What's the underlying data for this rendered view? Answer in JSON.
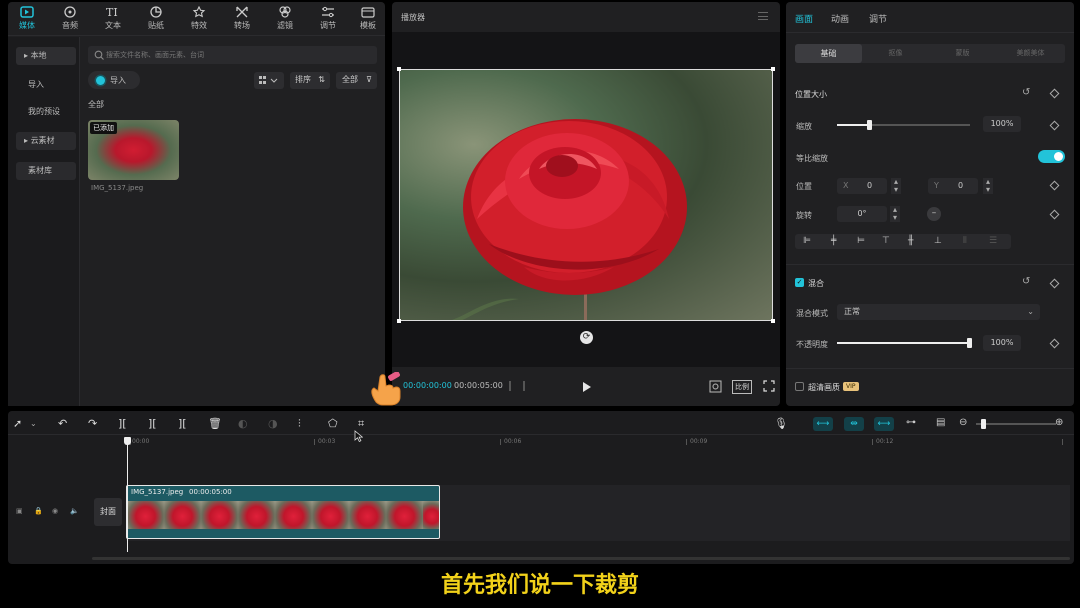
{
  "toolbar_tabs": [
    {
      "label": "媒体",
      "icon": "media-icon",
      "active": true
    },
    {
      "label": "音频",
      "icon": "audio-icon"
    },
    {
      "label": "文本",
      "icon": "text-icon"
    },
    {
      "label": "贴纸",
      "icon": "sticker-icon"
    },
    {
      "label": "特效",
      "icon": "effects-icon"
    },
    {
      "label": "转场",
      "icon": "transition-icon"
    },
    {
      "label": "滤镜",
      "icon": "filter-icon"
    },
    {
      "label": "调节",
      "icon": "adjust-icon"
    },
    {
      "label": "模板",
      "icon": "template-icon"
    }
  ],
  "sidebar": {
    "items": [
      "本地",
      "导入",
      "我的预设",
      "云素材",
      "素材库"
    ]
  },
  "media": {
    "search_placeholder": "搜索文件名称、画面元素、台词",
    "import_label": "导入",
    "sort_label": "排序",
    "filter_label": "全部",
    "section_label": "全部",
    "clip_badge": "已添加",
    "clip_name": "IMG_5137.jpeg"
  },
  "player": {
    "title": "播放器",
    "current_time": "00:00:00:00",
    "total_time": "00:00:05:00",
    "ratio_label": "比例"
  },
  "inspector": {
    "tabs": [
      "画面",
      "动画",
      "调节"
    ],
    "subtabs": [
      "基础",
      "抠像",
      "蒙版",
      "美颜美体"
    ],
    "position_size_title": "位置大小",
    "scale_label": "缩放",
    "scale_value": "100%",
    "scale_level": 0.25,
    "uniform_scale_label": "等比缩放",
    "position_label": "位置",
    "x_label": "X",
    "x_value": "0",
    "y_label": "Y",
    "y_value": "0",
    "rotate_label": "旋转",
    "rotate_value": "0°",
    "blend_title": "混合",
    "blend_mode_label": "混合模式",
    "blend_mode_value": "正常",
    "opacity_label": "不透明度",
    "opacity_value": "100%",
    "opacity_level": 1.0,
    "hd_label": "超清画质",
    "vip_badge": "VIP"
  },
  "timeline": {
    "ticks": [
      "00:00",
      "00:03",
      "00:06",
      "00:09",
      "00:12"
    ],
    "cover_label": "封面",
    "clip_name": "IMG_5137.jpeg",
    "clip_duration": "00:00:05:00"
  },
  "caption": "首先我们说一下裁剪",
  "colors": {
    "accent": "#22c3d9",
    "panel": "#202022",
    "clip_border": "#2aa8b8"
  }
}
